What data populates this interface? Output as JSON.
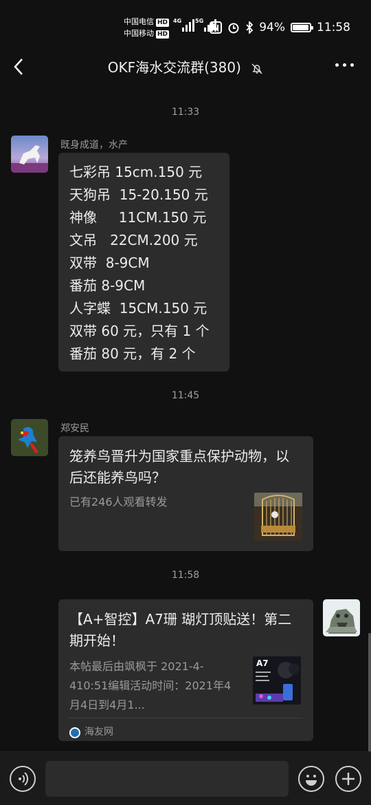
{
  "status": {
    "carrier1": "中国电信",
    "carrier2": "中国移动",
    "hd": "HD",
    "net1": "4G",
    "net2": "5G",
    "battery_pct": 94,
    "battery_text": "94%",
    "time": "11:58"
  },
  "header": {
    "title": "OKF海水交流群(380)"
  },
  "messages": {
    "t1": "11:33",
    "m1": {
      "sender": "既身成道，水产",
      "text": "七彩吊 15cm.150 元\n天狗吊  15-20.150 元\n神像     11CM.150 元\n文吊   22CM.200 元\n双带  8-9CM\n番茄 8-9CM\n人字蝶  15CM.150 元\n双带 60 元，只有 1 个\n番茄 80 元，有 2 个"
    },
    "t2": "11:45",
    "m2": {
      "sender": "郑安民",
      "title": "笼养鸟晋升为国家重点保护动物，以后还能养鸟吗？",
      "desc": "已有246人观看转发"
    },
    "t3": "11:58",
    "m3": {
      "title": "【A+智控】A7珊 瑚灯顶贴送！第二期开始！",
      "desc": "本帖最后由飒枫于 2021-4-410:51编辑活动时间：2021年4月4日到4月1...",
      "source": "海友网",
      "thumb_text": "A7"
    }
  },
  "colors": {
    "background": "#111111",
    "bubble": "#2c2c2c"
  }
}
